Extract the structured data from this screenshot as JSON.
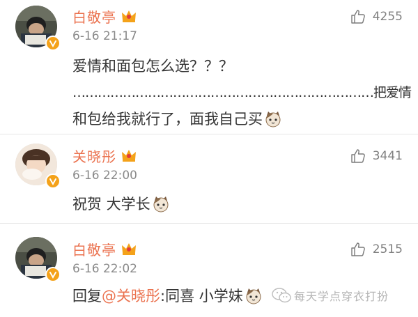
{
  "comments": [
    {
      "username": "白敬亭",
      "time": "6-16 21:17",
      "likes": "4255",
      "lines": [
        "爱情和面包怎么选？？？",
        "………………………………………………………………把爱情",
        "和包给我就行了，面我自己买"
      ],
      "avatar_icon": "boy-reading-avatar",
      "badge_icon": "verified-v-icon",
      "vip_icon": "crown-icon",
      "emoji_icon": "cat-emoji-icon"
    },
    {
      "username": "关晓彤",
      "time": "6-16 22:00",
      "likes": "3441",
      "lines": [
        "祝贺 大学长"
      ],
      "avatar_icon": "girl-avatar",
      "badge_icon": "verified-v-icon",
      "vip_icon": "crown-icon",
      "emoji_icon": "cat-emoji-icon"
    },
    {
      "username": "白敬亭",
      "time": "6-16 22:02",
      "likes": "2515",
      "reply_prefix": "回复",
      "mention": "@关晓彤",
      "reply_text": ":同喜 小学妹",
      "avatar_icon": "boy-reading-avatar",
      "badge_icon": "verified-v-icon",
      "vip_icon": "crown-icon",
      "emoji_icon": "cat-emoji-icon"
    }
  ],
  "watermark": {
    "text": "每天学点穿衣打扮",
    "icon": "wechat-icon"
  },
  "colors": {
    "username": "#eb7350",
    "badge": "#f4a21a",
    "meta": "#8a8a8a",
    "text": "#333333"
  }
}
